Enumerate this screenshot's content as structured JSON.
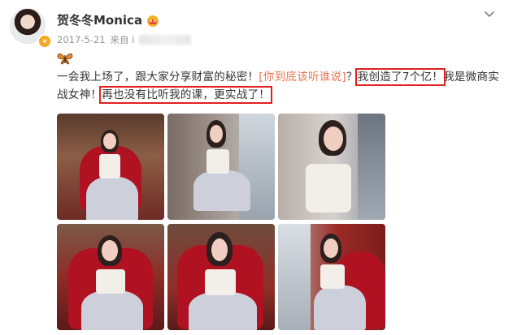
{
  "post": {
    "username": "贺冬冬Monica",
    "date": "2017-5-21",
    "source_prefix": "来自",
    "source_first_char": "i",
    "content_part1": "一会我上场了，跟大家分享财富的秘密！",
    "topic_link": "[你到底该听谁说]",
    "content_part2": "？",
    "highlight1": "我创造了7个亿！",
    "content_part3": "我是微商实战女神！",
    "highlight2": "再也没有比听我的课，更实战了！"
  },
  "icons": {
    "avatar": "avatar",
    "verified": "verified-badge-icon",
    "crown": "crown-icon",
    "chevron": "chevron-down-icon",
    "emoji": "butterfly-emoji-icon"
  },
  "colors": {
    "highlight_box": "#e02020",
    "link": "#eb7350",
    "verified": "#f5a623"
  },
  "photos": [
    {
      "label": "photo-1"
    },
    {
      "label": "photo-2"
    },
    {
      "label": "photo-3"
    },
    {
      "label": "photo-4"
    },
    {
      "label": "photo-5"
    },
    {
      "label": "photo-6"
    }
  ]
}
